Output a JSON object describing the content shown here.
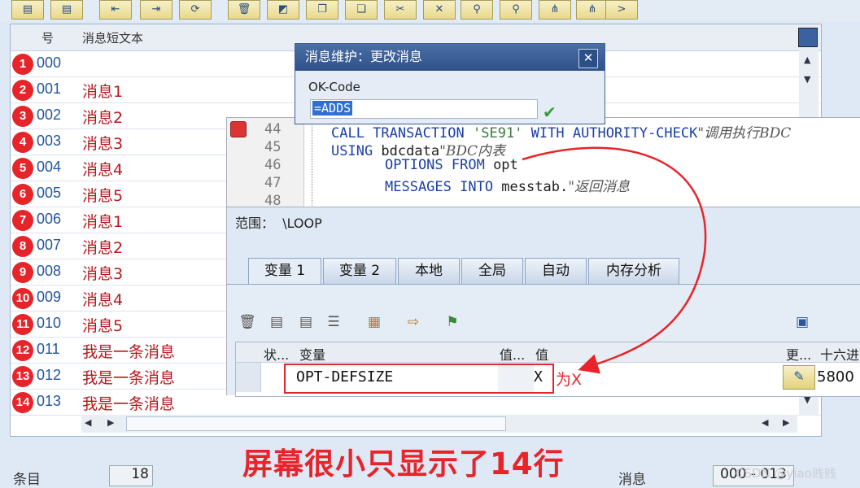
{
  "toolbar": {
    "more_label": ">"
  },
  "table": {
    "col_num_header": "号",
    "col_text_header": "消息短文本",
    "rows": [
      {
        "badge": "1",
        "num": "000",
        "text": ""
      },
      {
        "badge": "2",
        "num": "001",
        "text": "消息1"
      },
      {
        "badge": "3",
        "num": "002",
        "text": "消息2"
      },
      {
        "badge": "4",
        "num": "003",
        "text": "消息3"
      },
      {
        "badge": "5",
        "num": "004",
        "text": "消息4"
      },
      {
        "badge": "6",
        "num": "005",
        "text": "消息5"
      },
      {
        "badge": "7",
        "num": "006",
        "text": "消息1"
      },
      {
        "badge": "8",
        "num": "007",
        "text": "消息2"
      },
      {
        "badge": "9",
        "num": "008",
        "text": "消息3"
      },
      {
        "badge": "10",
        "num": "009",
        "text": "消息4"
      },
      {
        "badge": "11",
        "num": "010",
        "text": "消息5"
      },
      {
        "badge": "12",
        "num": "011",
        "text": "我是一条消息"
      },
      {
        "badge": "13",
        "num": "012",
        "text": "我是一条消息"
      },
      {
        "badge": "14",
        "num": "013",
        "text": "我是一条消息"
      }
    ]
  },
  "status": {
    "entries_label": "条目",
    "entries_count": "18",
    "msg_label": "消息",
    "range": "000 - 013"
  },
  "watermark": "CSDN @yiao贱贱",
  "caption": "屏幕很小只显示了14行",
  "dialog": {
    "title": "消息维护：更改消息",
    "close": "✕",
    "okcode_label": "OK-Code",
    "okcode_value": "=ADDS"
  },
  "code": {
    "lines": [
      {
        "no": "44",
        "kw1": "CALL TRANSACTION ",
        "str": "'SE91'",
        "kw2": " WITH AUTHORITY-CHECK",
        "comment": "\"调用执行BDC"
      },
      {
        "no": "45",
        "kw1": "USING ",
        "blk": "bdcdata",
        "comment": "\"BDC内表"
      },
      {
        "no": "46",
        "kw1": "OPTIONS FROM ",
        "blk": "opt"
      },
      {
        "no": "47",
        "kw1": "MESSAGES INTO ",
        "blk": "messtab.",
        "comment": "\"返回消息"
      },
      {
        "no": "48"
      }
    ]
  },
  "debugger": {
    "scope_label": "范围：",
    "scope_value": "\\LOOP",
    "tabs": [
      "变量 1",
      "变量 2",
      "本地",
      "全局",
      "自动",
      "内存分析"
    ],
    "grid_headers": {
      "status": "状...",
      "variable": "变量",
      "value_short": "值...",
      "value": "值",
      "more": "更...",
      "hex": "十六进"
    },
    "row": {
      "variable": "OPT-DEFSIZE",
      "value": "X",
      "hex": "5800"
    }
  },
  "annotation": "为X",
  "colors": {
    "accent_red": "#e8242a",
    "title_blue": "#2e5189"
  }
}
